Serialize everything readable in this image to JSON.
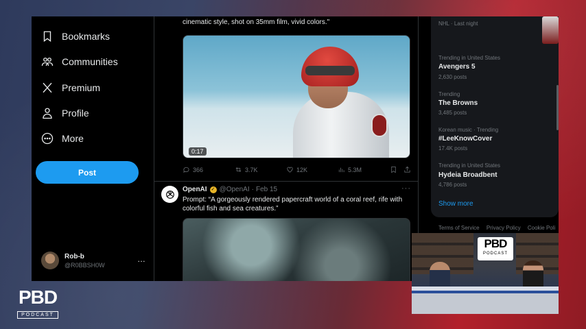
{
  "nav": {
    "items": [
      {
        "label": "Bookmarks",
        "icon": "bookmark-icon"
      },
      {
        "label": "Communities",
        "icon": "communities-icon"
      },
      {
        "label": "Premium",
        "icon": "x-logo-icon"
      },
      {
        "label": "Profile",
        "icon": "person-icon"
      },
      {
        "label": "More",
        "icon": "more-circle-icon"
      }
    ],
    "post_label": "Post",
    "account": {
      "name": "Rob-b",
      "handle": "@R0BBSH0W",
      "more": "…"
    }
  },
  "tweet1": {
    "prompt_tail": "cinematic style, shot on 35mm film, vivid colors.\"",
    "duration": "0:17",
    "replies": "366",
    "reposts": "3.7K",
    "likes": "12K",
    "views": "5.3M"
  },
  "tweet2": {
    "name": "OpenAI",
    "handle": "@OpenAI",
    "date": "Feb 15",
    "separator": "·",
    "more": "···",
    "prompt": "Prompt: “A gorgeously rendered papercraft world of a coral reef, rife with colorful fish and sea creatures.”"
  },
  "trends": {
    "first": {
      "meta": "NHL · Last night"
    },
    "items": [
      {
        "meta": "Trending in United States",
        "title": "Avengers 5",
        "count": "2,630 posts"
      },
      {
        "meta": "Trending",
        "title": "The Browns",
        "count": "3,485 posts"
      },
      {
        "meta": "Korean music · Trending",
        "title": "#LeeKnowCover",
        "count": "17.4K posts"
      },
      {
        "meta": "Trending in United States",
        "title": "Hydeia Broadbent",
        "count": "4,786 posts"
      }
    ],
    "show_more": "Show more",
    "footer": [
      "Terms of Service",
      "Privacy Policy",
      "Cookie Poli"
    ]
  },
  "overlay": {
    "logo_big": "PBD",
    "logo_small": "PODCAST"
  },
  "colors": {
    "accent": "#1d9bf0",
    "background": "#000000",
    "muted": "#71767b",
    "verified": "#e8b528"
  }
}
